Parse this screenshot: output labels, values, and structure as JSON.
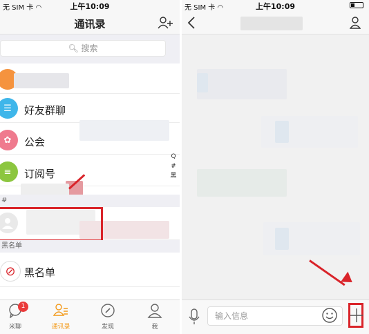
{
  "left_screen": {
    "status": {
      "carrier": "无 SIM 卡 ",
      "time": "上午10:09"
    },
    "title": "通讯录",
    "search_placeholder": "搜索",
    "rows": [
      {
        "label": "好友群聊"
      },
      {
        "label": "公会"
      },
      {
        "label": "订阅号"
      }
    ],
    "section_hash": "#",
    "section_blacklist": "黑名单",
    "blacklist_row": "黑名单",
    "index_letters": [
      "Q",
      "#",
      "黑"
    ],
    "tabs": [
      {
        "label": "米聊",
        "badge": "1"
      },
      {
        "label": "通讯录"
      },
      {
        "label": "发现"
      },
      {
        "label": "我"
      }
    ]
  },
  "right_screen": {
    "status": {
      "carrier": "无 SIM 卡 ",
      "time": "上午10:09"
    },
    "input_placeholder": "输入信息"
  },
  "colors": {
    "accent": "#f39a1a",
    "highlight": "#d9242a",
    "avatar_orange": "#f5933e",
    "avatar_blue": "#3fb6ea",
    "avatar_pink": "#ef7a8e",
    "avatar_green": "#8cc63f"
  }
}
